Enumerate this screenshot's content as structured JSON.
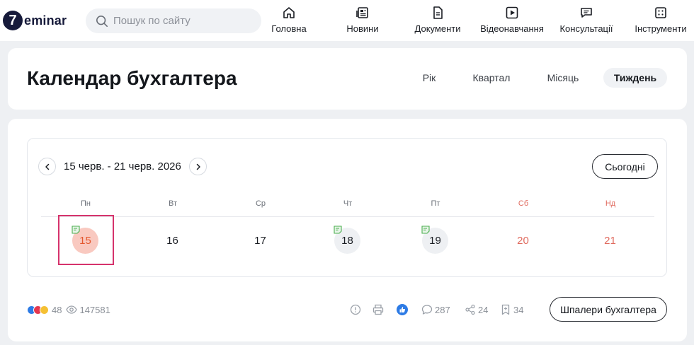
{
  "header": {
    "logo_digit": "7",
    "logo_text": "eminar",
    "search_placeholder": "Пошук по сайту",
    "nav": [
      {
        "label": "Головна",
        "icon": "home-icon"
      },
      {
        "label": "Новини",
        "icon": "newspaper-icon"
      },
      {
        "label": "Документи",
        "icon": "document-icon"
      },
      {
        "label": "Відеонавчання",
        "icon": "video-play-icon"
      },
      {
        "label": "Консультації",
        "icon": "chat-icon"
      },
      {
        "label": "Інструменти",
        "icon": "tools-icon"
      }
    ]
  },
  "title_card": {
    "title": "Календар бухгалтера",
    "periods": [
      "Рік",
      "Квартал",
      "Місяць",
      "Тиждень"
    ],
    "active_period": "Тиждень"
  },
  "calendar": {
    "range": "15 черв. - 21 черв. 2026",
    "today_label": "Сьогодні",
    "weekdays": [
      "Пн",
      "Вт",
      "Ср",
      "Чт",
      "Пт",
      "Сб",
      "Нд"
    ],
    "days": [
      {
        "num": "15",
        "has_event": true,
        "current": true,
        "weekend": false
      },
      {
        "num": "16",
        "has_event": false,
        "current": false,
        "weekend": false
      },
      {
        "num": "17",
        "has_event": false,
        "current": false,
        "weekend": false
      },
      {
        "num": "18",
        "has_event": true,
        "current": false,
        "weekend": false
      },
      {
        "num": "19",
        "has_event": true,
        "current": false,
        "weekend": false
      },
      {
        "num": "20",
        "has_event": false,
        "current": false,
        "weekend": true
      },
      {
        "num": "21",
        "has_event": false,
        "current": false,
        "weekend": true
      }
    ]
  },
  "footer": {
    "reactions_count": "48",
    "views_count": "147581",
    "comments_count": "287",
    "shares_count": "24",
    "bookmarks_count": "34",
    "wallpaper_label": "Шпалери бухгалтера"
  },
  "colors": {
    "accent_current_day": "#e4572e",
    "current_day_bg": "#f9c9c0",
    "weekend": "#e06b5f",
    "event_icon": "#4caf50",
    "like_blue": "#2d7be5",
    "highlight_border": "#d6336c"
  }
}
